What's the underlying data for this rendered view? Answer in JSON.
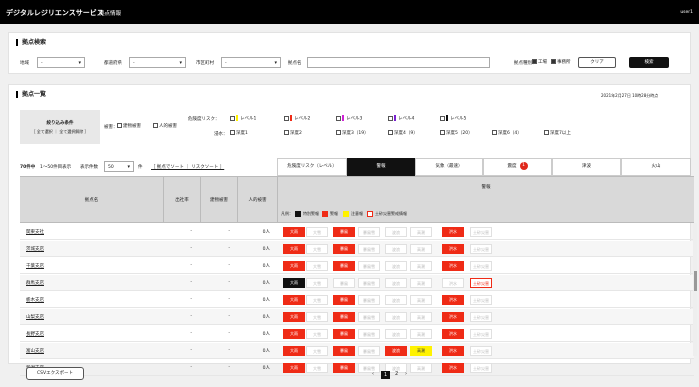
{
  "app": {
    "title": "デジタルレジリエンスサービス",
    "page": "拠点情報",
    "user": "user1"
  },
  "search": {
    "title": "拠点検索",
    "region_label": "地域",
    "region_value": "-",
    "pref_label": "都道府県",
    "pref_value": "-",
    "city_label": "市区町村",
    "city_value": "-",
    "name_label": "拠点名",
    "name_value": "",
    "type_label": "拠点種別：",
    "type_factory": "工場",
    "type_office": "事務所",
    "clear": "クリア",
    "search": "検索"
  },
  "list": {
    "title": "拠点一覧",
    "timestamp": "2021年2月27日 10時28分時点",
    "filter_title": "絞り込み条件",
    "filter_sub": "［ 全て選択 ｜ 全て選択解除 ］",
    "damage_label": "被害：",
    "damage_building": "建物被害",
    "damage_human": "人的被害",
    "risk_label": "危険度リスク：",
    "levels": [
      "レベル1",
      "レベル2",
      "レベル3",
      "レベル4",
      "レベル5"
    ],
    "level_colors": [
      "#fff200",
      "#ef2b16",
      "#cf23d6",
      "#7a20d0",
      "#111111"
    ],
    "floor_label": "浸水：",
    "floors": [
      "深度1",
      "深度2",
      "深度3（19）",
      "深度4（9）",
      "深度5（20）",
      "深度6（4）",
      "深度7以上"
    ],
    "count": "70件中",
    "range": "1〜50件目表示",
    "per_page_label": "表示件数",
    "per_page": "50",
    "per_page_unit": "件",
    "sort": "［ 拠点でソート ｜ リスクソート ］",
    "csv": "CSVエクスポート",
    "pages": [
      "1",
      "2"
    ]
  },
  "tabs": [
    "危険度リスク（レベル）",
    "警報",
    "気象（最速）",
    "震度",
    "津波",
    "火山"
  ],
  "tab_badge": "1",
  "columns": {
    "name": "拠点名",
    "office": "出社率",
    "building": "建物被害",
    "human": "人的被害",
    "warning": "警報"
  },
  "legend": {
    "prefix": "凡例：",
    "items": [
      "特別警報",
      "警報",
      "注意報",
      "土砂災害警戒情報"
    ]
  },
  "chip_labels": [
    "大雨",
    "大雪",
    "暴風",
    "暴風雪",
    "波浪",
    "高潮",
    "洪水",
    "土砂災害"
  ],
  "rows": [
    {
      "name": "関東支社",
      "office": "-",
      "building": "-",
      "human": "0人",
      "chips": [
        "r",
        "",
        "r",
        "",
        "",
        "",
        "r",
        ""
      ]
    },
    {
      "name": "茨城支店",
      "office": "-",
      "building": "-",
      "human": "0人",
      "chips": [
        "r",
        "",
        "r",
        "",
        "",
        "",
        "r",
        ""
      ]
    },
    {
      "name": "千葉支店",
      "office": "-",
      "building": "-",
      "human": "0人",
      "chips": [
        "r",
        "",
        "r",
        "",
        "",
        "",
        "r",
        ""
      ]
    },
    {
      "name": "群馬支店",
      "office": "-",
      "building": "-",
      "human": "0人",
      "chips": [
        "k",
        "",
        "",
        "",
        "",
        "",
        "",
        "o"
      ]
    },
    {
      "name": "栃木支店",
      "office": "-",
      "building": "-",
      "human": "0人",
      "chips": [
        "r",
        "",
        "r",
        "",
        "",
        "",
        "r",
        ""
      ]
    },
    {
      "name": "山梨支店",
      "office": "-",
      "building": "-",
      "human": "0人",
      "chips": [
        "r",
        "",
        "r",
        "",
        "",
        "",
        "r",
        ""
      ]
    },
    {
      "name": "長野支店",
      "office": "-",
      "building": "-",
      "human": "0人",
      "chips": [
        "r",
        "",
        "r",
        "",
        "",
        "",
        "r",
        ""
      ]
    },
    {
      "name": "富山支店",
      "office": "-",
      "building": "-",
      "human": "0人",
      "chips": [
        "r",
        "",
        "r",
        "",
        "r",
        "y",
        "r",
        ""
      ]
    },
    {
      "name": "新潟支店",
      "office": "-",
      "building": "-",
      "human": "0人",
      "chips": [
        "r",
        "",
        "r",
        "",
        "",
        "",
        "r",
        ""
      ]
    }
  ]
}
